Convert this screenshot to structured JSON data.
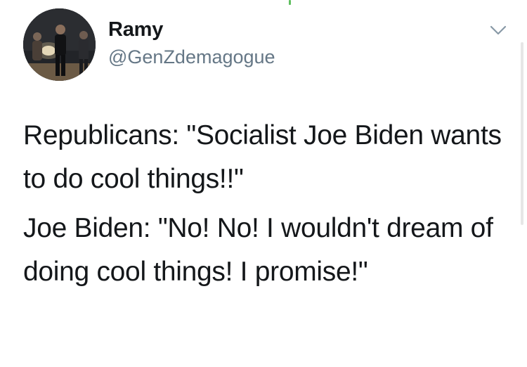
{
  "tweet": {
    "display_name": "Ramy",
    "handle": "@GenZdemagogue",
    "avatar_icon": "profile-photo",
    "menu_icon": "chevron-down-icon",
    "paragraphs": [
      "Republicans: \"Socialist Joe Biden wants to do cool things!!\"",
      "Joe Biden: \"No! No! I wouldn't dream of doing cool things! I promise!\""
    ]
  },
  "colors": {
    "text": "#14171a",
    "secondary_text": "#657786",
    "background": "#ffffff",
    "caret": "#8899a6"
  }
}
